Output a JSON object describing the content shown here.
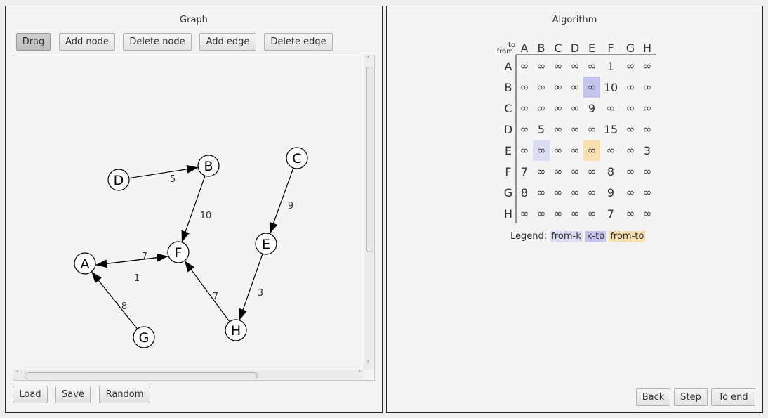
{
  "graph_panel": {
    "title": "Graph",
    "toolbar": {
      "drag": "Drag",
      "add_node": "Add node",
      "delete_node": "Delete node",
      "add_edge": "Add edge",
      "delete_edge": "Delete edge"
    },
    "nodes": [
      {
        "id": "A",
        "label": "A"
      },
      {
        "id": "B",
        "label": "B"
      },
      {
        "id": "C",
        "label": "C"
      },
      {
        "id": "D",
        "label": "D"
      },
      {
        "id": "E",
        "label": "E"
      },
      {
        "id": "F",
        "label": "F"
      },
      {
        "id": "G",
        "label": "G"
      },
      {
        "id": "H",
        "label": "H"
      }
    ],
    "edges": [
      {
        "from": "D",
        "to": "B",
        "weight": "5"
      },
      {
        "from": "B",
        "to": "F",
        "weight": "10"
      },
      {
        "from": "C",
        "to": "E",
        "weight": "9"
      },
      {
        "from": "F",
        "to": "A",
        "weight": "7"
      },
      {
        "from": "A",
        "to": "F",
        "weight": "1"
      },
      {
        "from": "G",
        "to": "A",
        "weight": "8"
      },
      {
        "from": "H",
        "to": "F",
        "weight": "7"
      },
      {
        "from": "E",
        "to": "H",
        "weight": "3"
      }
    ],
    "bottom": {
      "load": "Load",
      "save": "Save",
      "random": "Random"
    }
  },
  "algorithm_panel": {
    "title": "Algorithm",
    "corner_to": "to",
    "corner_from": "from",
    "columns": [
      "A",
      "B",
      "C",
      "D",
      "E",
      "F",
      "G",
      "H"
    ],
    "rows": [
      {
        "label": "A",
        "cells": [
          "∞",
          "∞",
          "∞",
          "∞",
          "∞",
          "1",
          "∞",
          "∞"
        ]
      },
      {
        "label": "B",
        "cells": [
          "∞",
          "∞",
          "∞",
          "∞",
          "∞",
          "10",
          "∞",
          "∞"
        ]
      },
      {
        "label": "C",
        "cells": [
          "∞",
          "∞",
          "∞",
          "∞",
          "9",
          "∞",
          "∞",
          "∞"
        ]
      },
      {
        "label": "D",
        "cells": [
          "∞",
          "5",
          "∞",
          "∞",
          "∞",
          "15",
          "∞",
          "∞"
        ]
      },
      {
        "label": "E",
        "cells": [
          "∞",
          "∞",
          "∞",
          "∞",
          "∞",
          "∞",
          "∞",
          "3"
        ]
      },
      {
        "label": "F",
        "cells": [
          "7",
          "∞",
          "∞",
          "∞",
          "∞",
          "8",
          "∞",
          "∞"
        ]
      },
      {
        "label": "G",
        "cells": [
          "8",
          "∞",
          "∞",
          "∞",
          "∞",
          "9",
          "∞",
          "∞"
        ]
      },
      {
        "label": "H",
        "cells": [
          "∞",
          "∞",
          "∞",
          "∞",
          "∞",
          "7",
          "∞",
          "∞"
        ]
      }
    ],
    "highlights": [
      {
        "row": 4,
        "col": 1,
        "kind": "from-k"
      },
      {
        "row": 1,
        "col": 4,
        "kind": "k-to"
      },
      {
        "row": 4,
        "col": 4,
        "kind": "from-to"
      }
    ],
    "legend": {
      "label": "Legend:",
      "from_k": "from-k",
      "k_to": "k-to",
      "from_to": "from-to"
    },
    "colors": {
      "from_k": "#dcdcf4",
      "k_to": "#c4c4f0",
      "from_to": "#f9e0b0"
    },
    "buttons": {
      "back": "Back",
      "step": "Step",
      "to_end": "To end"
    }
  }
}
